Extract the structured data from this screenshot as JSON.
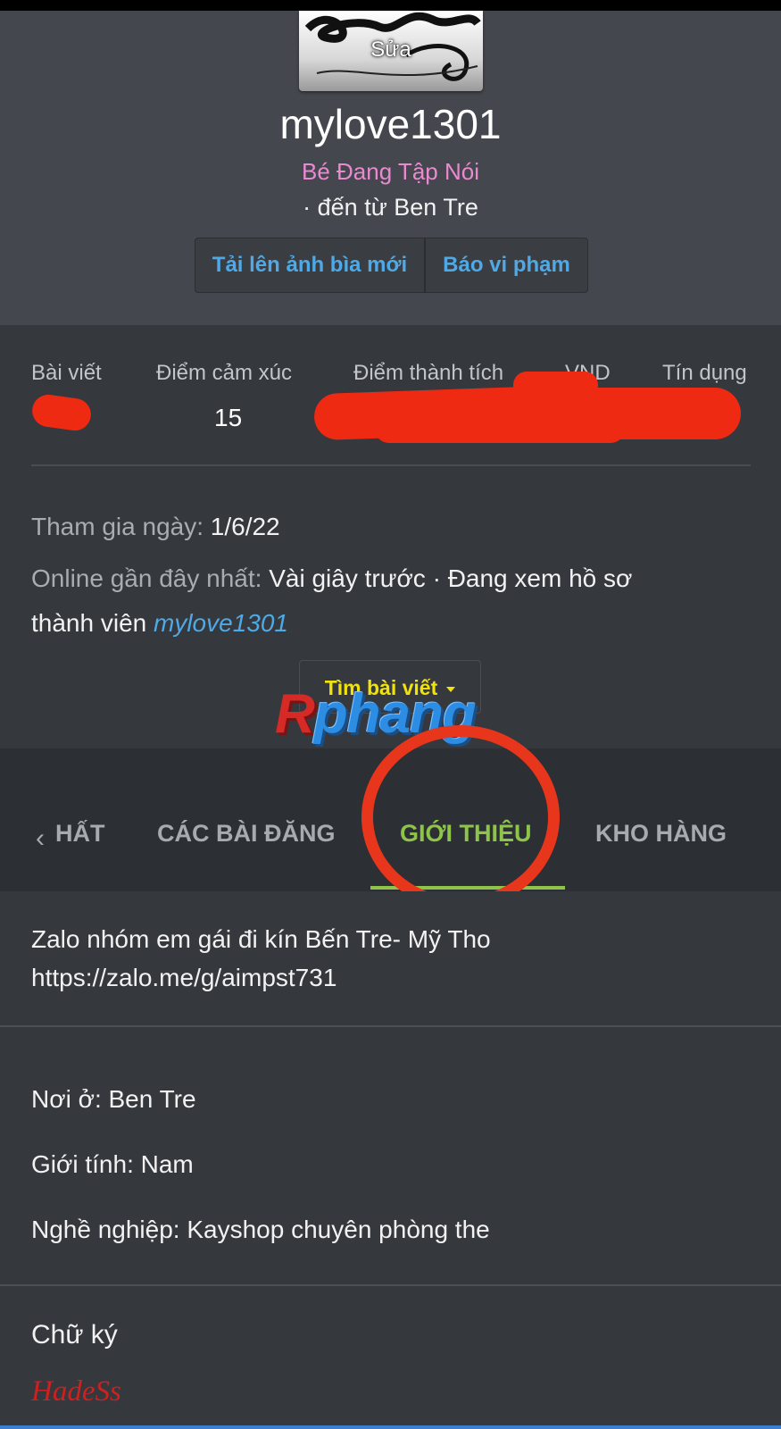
{
  "profile": {
    "avatar_edit_label": "Sửa",
    "username": "mylove1301",
    "user_title": "Bé Đang Tập Nói",
    "location_text": "· đến từ Ben Tre",
    "upload_cover_label": "Tải lên ảnh bìa mới",
    "report_label": "Báo vi phạm"
  },
  "stats": {
    "labels": [
      "Bài viết",
      "Điểm cảm xúc",
      "Điểm thành tích",
      "VND",
      "Tín dụng"
    ],
    "reaction_score": "15",
    "joined_label": "Tham gia ngày:",
    "joined_value": "1/6/22",
    "online_label": "Online gần đây nhất:",
    "online_value": "Vài giây trước · Đang xem hồ sơ",
    "online_value_2": "thành viên",
    "online_member": "mylove1301",
    "find_posts_label": "Tìm bài viết",
    "watermark": "Rphang",
    "watermark_r": "R",
    "watermark_rest": "phang"
  },
  "tabs": {
    "items": [
      "HẤT",
      "CÁC BÀI ĐĂNG",
      "GIỚI THIỆU",
      "KHO HÀNG"
    ],
    "active": "GIỚI THIỆU"
  },
  "about": {
    "line1": "Zalo nhóm em gái đi kín Bến Tre- Mỹ Tho",
    "line2": "https://zalo.me/g/aimpst731",
    "residence": "Nơi ở: Ben Tre",
    "gender": "Giới tính: Nam",
    "occupation": "Nghề nghiệp: Kayshop chuyên phòng the",
    "signature_label": "Chữ ký",
    "signature": "HadeSs"
  },
  "colors": {
    "accent_link": "#4ea9e6",
    "active_tab": "#8fc44a",
    "user_title": "#e98ad1",
    "annotation_red": "#e8361c"
  }
}
